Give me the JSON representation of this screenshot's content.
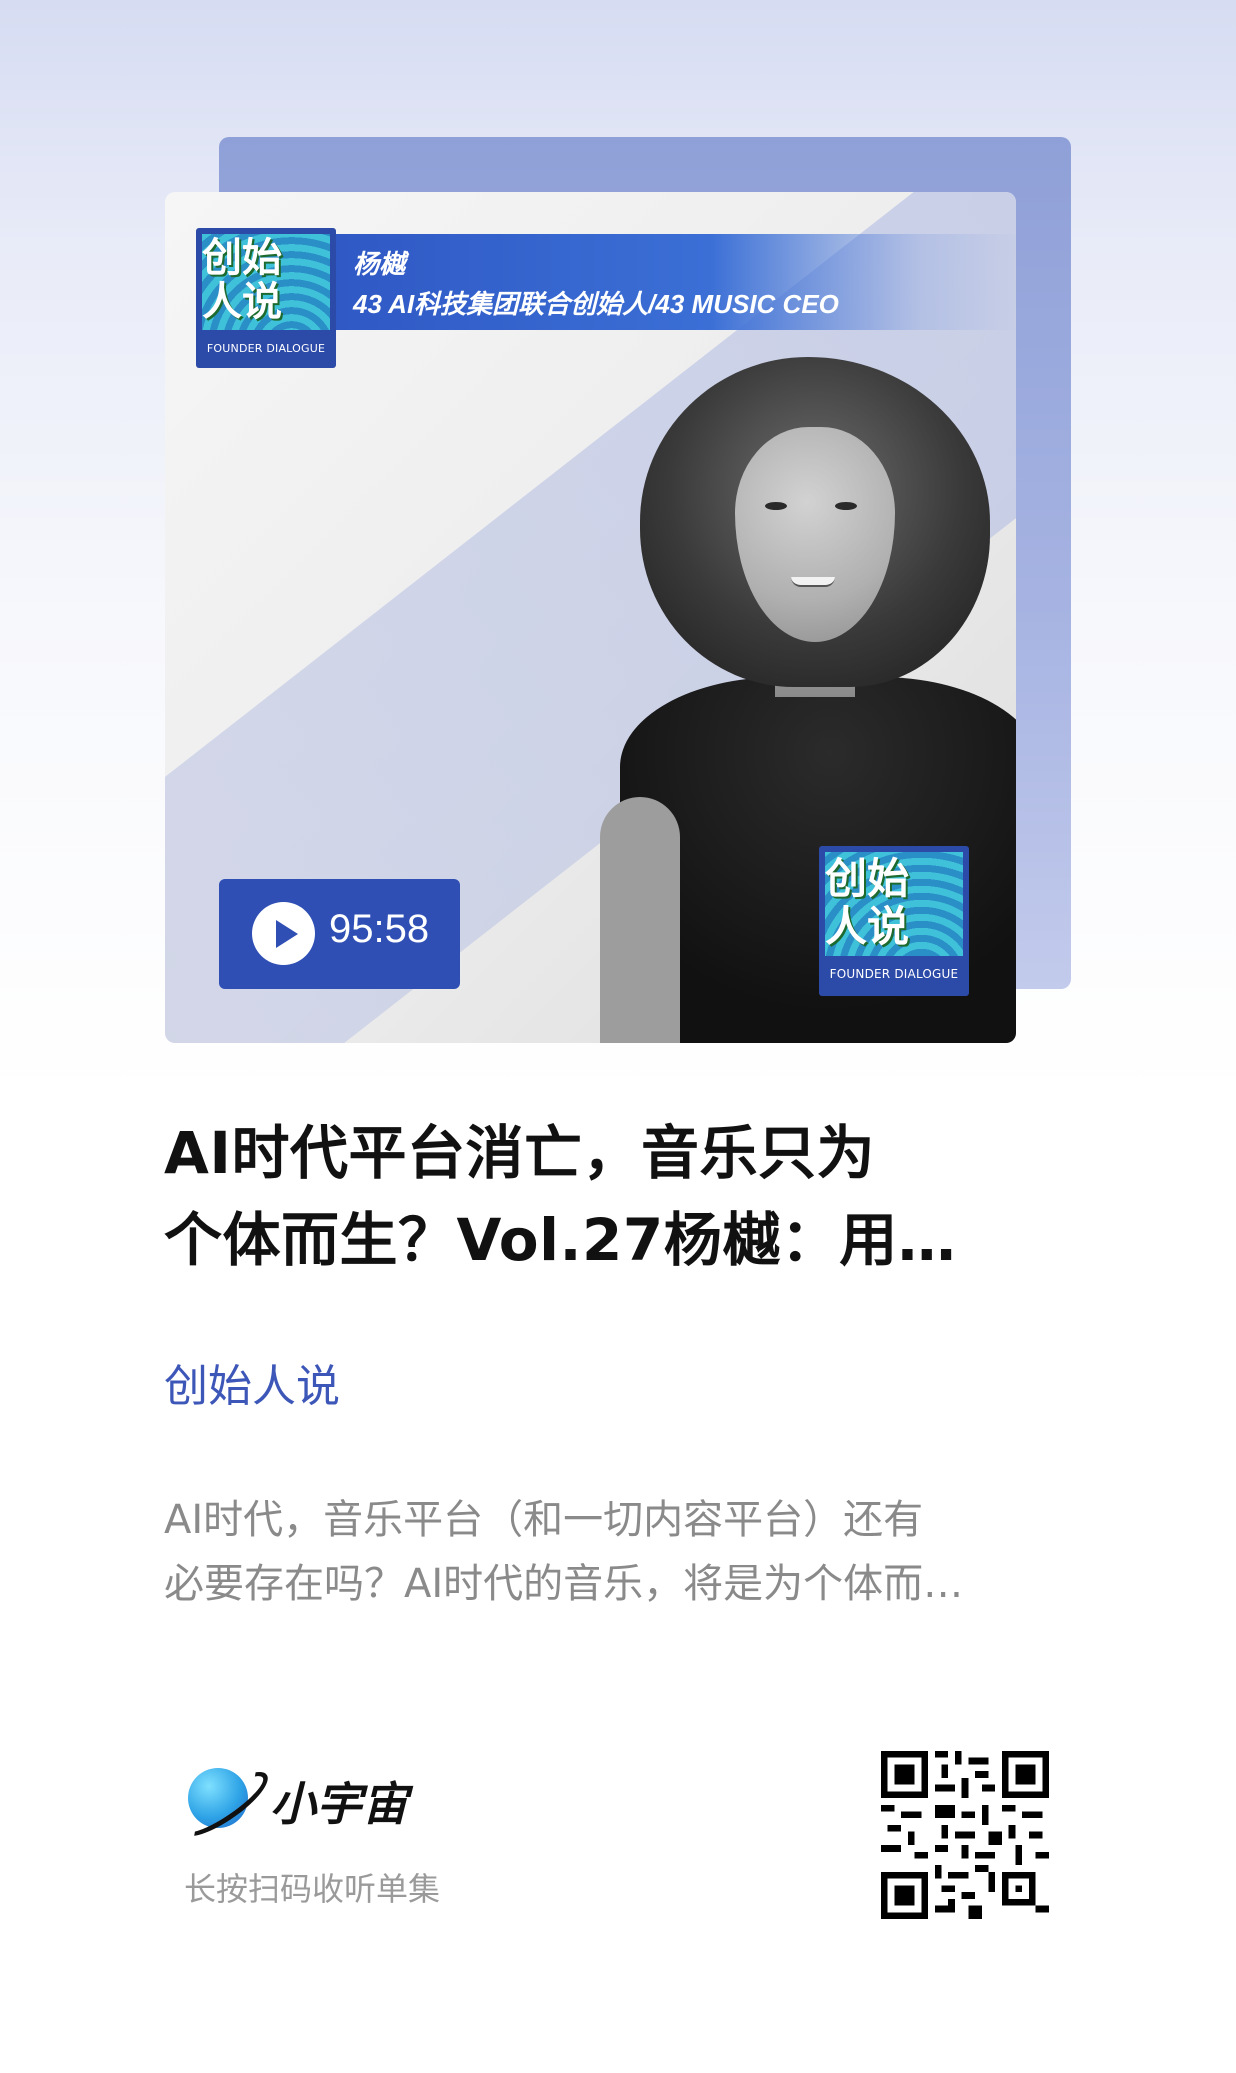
{
  "cover": {
    "guest_name": "杨樾",
    "guest_role": "43 AI科技集团联合创始人/43 MUSIC CEO",
    "logo_line1": "创始",
    "logo_line2": "人说",
    "logo_sub": "FOUNDER DIALOGUE",
    "duration": "95:58"
  },
  "episode": {
    "title_line1": "AI时代平台消亡，音乐只为",
    "title_line2": "个体而生？Vol.27杨樾：用…",
    "channel": "创始人说",
    "description_line1": "AI时代，音乐平台（和一切内容平台）还有",
    "description_line2": "必要存在吗？AI时代的音乐，将是为个体而…"
  },
  "footer": {
    "brand": "小宇宙",
    "hint": "长按扫码收听单集"
  },
  "colors": {
    "accent": "#2f4fb5",
    "channel": "#3d57b8",
    "brand_blue": "#2ea3e6"
  }
}
